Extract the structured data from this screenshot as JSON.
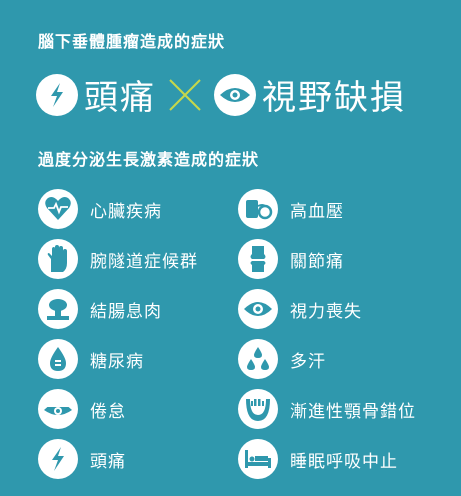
{
  "header": {
    "title": "腦下垂體腫瘤造成的症狀",
    "headline_left": "頭痛",
    "headline_right": "視野缺損"
  },
  "section2": {
    "title": "過度分泌生長激素造成的症狀"
  },
  "symptoms_left": [
    {
      "label": "心臟疾病",
      "icon": "heart-pulse-icon"
    },
    {
      "label": "腕隧道症候群",
      "icon": "hand-icon"
    },
    {
      "label": "結腸息肉",
      "icon": "colon-polyp-icon"
    },
    {
      "label": "糖尿病",
      "icon": "blood-drop-icon"
    },
    {
      "label": "倦怠",
      "icon": "tired-eye-icon"
    },
    {
      "label": "頭痛",
      "icon": "headache-bolt-icon"
    }
  ],
  "symptoms_right": [
    {
      "label": "高血壓",
      "icon": "blood-pressure-cuff-icon"
    },
    {
      "label": "關節痛",
      "icon": "joint-icon"
    },
    {
      "label": "視力喪失",
      "icon": "eye-icon"
    },
    {
      "label": "多汗",
      "icon": "sweat-drops-icon"
    },
    {
      "label": "漸進性顎骨錯位",
      "icon": "jaw-icon"
    },
    {
      "label": "睡眠呼吸中止",
      "icon": "sleep-bed-icon"
    }
  ],
  "colors": {
    "background": "#2f98ad",
    "icon_fill": "#2f98ad",
    "cross": "#c6d84a"
  }
}
